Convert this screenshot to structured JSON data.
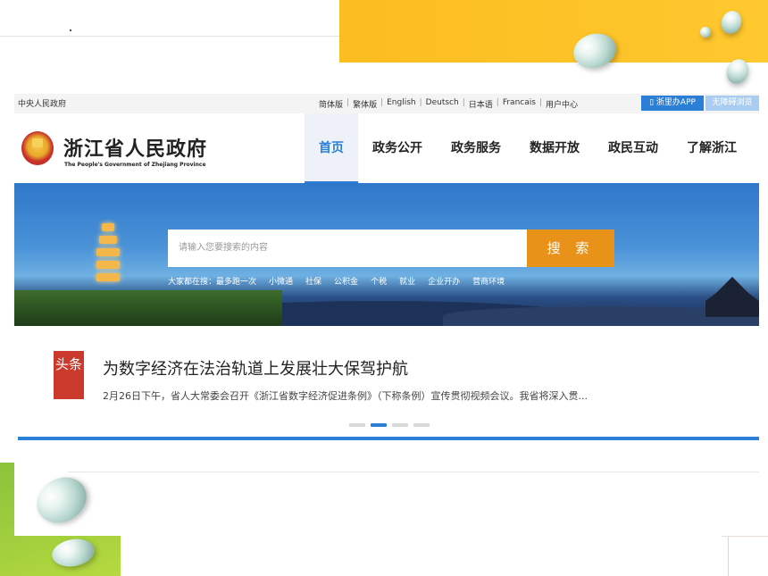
{
  "topbar": {
    "gov_link": "中央人民政府",
    "languages": [
      "简体版",
      "繁体版",
      "English",
      "Deutsch",
      "日本语",
      "Francais",
      "用户中心"
    ],
    "separator": "|",
    "app_button": "浙里办APP",
    "accessible_button": "无障碍浏览"
  },
  "header": {
    "site_name": "浙江省人民政府",
    "site_name_en": "The People's Government of Zhejiang Province",
    "nav": [
      "首页",
      "政务公开",
      "政务服务",
      "数据开放",
      "政民互动",
      "了解浙江"
    ],
    "active_nav": "首页"
  },
  "banner": {
    "search_placeholder": "请输入您要搜索的内容",
    "search_button": "搜 索",
    "hot_searches": [
      "大家都在搜：最多跑一次",
      "小微通",
      "社保",
      "公积金",
      "个税",
      "就业",
      "企业开办",
      "营商环境"
    ]
  },
  "headline": {
    "tag": "头条",
    "title": "为数字经济在法治轨道上发展壮大保驾护航",
    "description": "2月26日下午，省人大常委会召开《浙江省数字经济促进条例》（下称条例）宣传贯彻视频会议。我省将深入贯...",
    "carousel_total": 4,
    "carousel_active": 2
  },
  "colors": {
    "accent_blue": "#2b7fd6",
    "search_orange": "#e8921a",
    "tag_red": "#c9392c",
    "slide_yellow": "#fbbd1f",
    "slide_green": "#8ac33c"
  }
}
